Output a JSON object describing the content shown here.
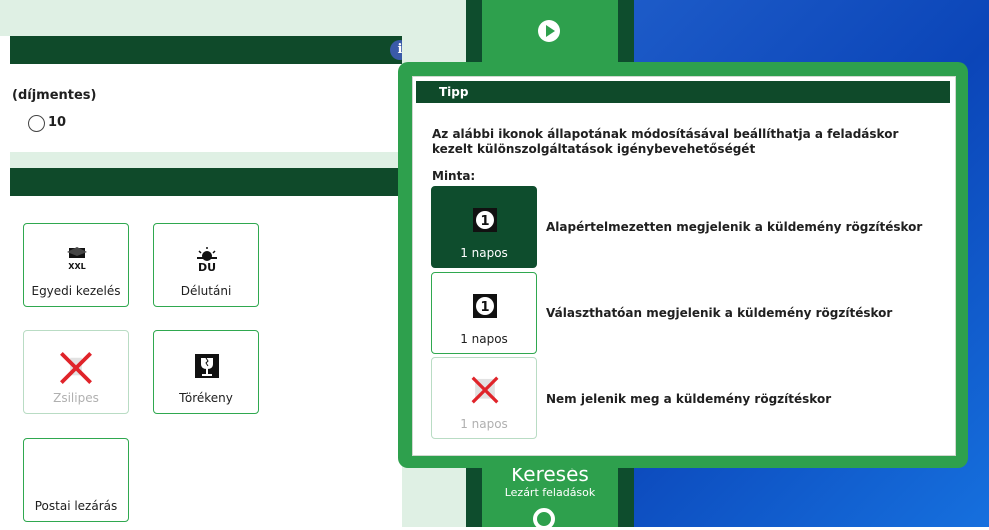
{
  "left": {
    "fee_label": "(díjmentes)",
    "radio_value": "10",
    "tiles": [
      {
        "label": "Egyedi kezelés",
        "icon": "xxl-package-icon"
      },
      {
        "label": "Délutáni",
        "icon": "du-sunset-icon"
      },
      {
        "label": "Zsilipes",
        "icon": "disabled-cross-icon"
      },
      {
        "label": "Törékeny",
        "icon": "fragile-icon"
      },
      {
        "label": "Postai lezárás",
        "icon": ""
      }
    ]
  },
  "middle": {
    "search_title": "Keresés",
    "search_subtitle": "Lezárt feladások"
  },
  "tooltip": {
    "title": "Tipp",
    "description": "Az alábbi ikonok állapotának módosításával beállíthatja a feladáskor kezelt különszolgáltatások igénybevehetőségét",
    "sample_heading": "Minta:",
    "samples": [
      {
        "label": "1 napos",
        "text": "Alapértelmezetten megjelenik  a küldemény rögzítéskor"
      },
      {
        "label": "1 napos",
        "text": "Választhatóan megjelenik a küldemény rögzítéskor"
      },
      {
        "label": "1 napos",
        "text": "Nem jelenik meg a küldemény rögzítéskor"
      }
    ]
  },
  "colors": {
    "dark_green": "#0e4d2d",
    "accent_green": "#2ea04d",
    "blue": "#0b45b8",
    "mint": "#dff0e4"
  }
}
